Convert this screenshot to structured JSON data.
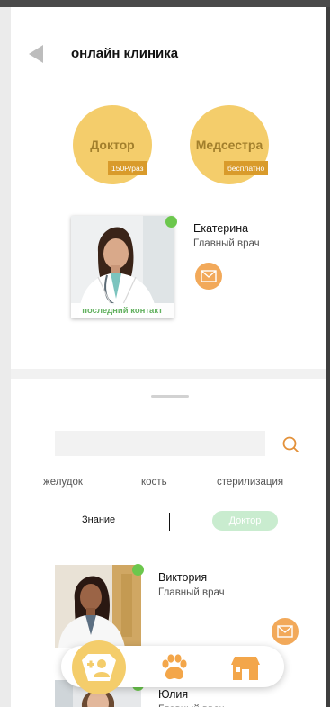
{
  "header": {
    "title": "онлайн клиника",
    "back_icon": "back-arrow-icon"
  },
  "roles": [
    {
      "name": "Доктор",
      "tag": "150Р/раз"
    },
    {
      "name": "Медсестра",
      "tag": "бесплатно"
    }
  ],
  "last_contact": {
    "name": "Екатерина",
    "role": "Главный врач",
    "caption": "последний контакт",
    "status": "online",
    "message_icon": "mail-icon"
  },
  "search": {
    "value": "",
    "placeholder": "",
    "icon": "search-icon"
  },
  "categories": [
    "желудок",
    "кость",
    "стерилизация"
  ],
  "toggle": {
    "left_label": "Знание",
    "right_label": "Доктор",
    "selected": "Доктор"
  },
  "doctors": [
    {
      "name": "Виктория",
      "role": "Главный врач",
      "status": "online"
    },
    {
      "name": "Юлия",
      "role": "Главный врач",
      "status": "online"
    }
  ],
  "nav": {
    "items": [
      "clinic-icon",
      "paw-icon",
      "house-icon"
    ],
    "active": "clinic-icon"
  },
  "colors": {
    "accent_yellow": "#f4cd6b",
    "tag_orange": "#d99b2b",
    "message_orange": "#f2a95a",
    "online_green": "#6cc74d",
    "caption_green": "#62b15f",
    "toggle_selected": "#c9eccf"
  }
}
